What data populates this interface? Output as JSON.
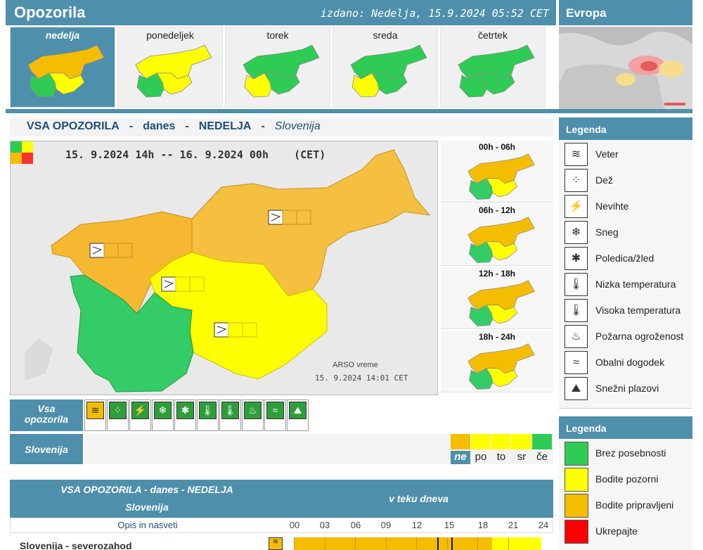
{
  "header": {
    "title": "Opozorila",
    "issued": "izdano: Nedelja, 15.9.2024 05:52 CET",
    "europe": "Evropa"
  },
  "days": [
    {
      "label": "nedelja",
      "active": true,
      "fill": [
        "#f5bd00",
        "#ffff00",
        "#2ecc54"
      ]
    },
    {
      "label": "ponedeljek",
      "active": false,
      "fill": [
        "#ffff00",
        "#ffff00",
        "#2ecc54"
      ]
    },
    {
      "label": "torek",
      "active": false,
      "fill": [
        "#2ecc54",
        "#2ecc54",
        "#ffff00"
      ]
    },
    {
      "label": "sreda",
      "active": false,
      "fill": [
        "#2ecc54",
        "#2ecc54",
        "#ffff00"
      ]
    },
    {
      "label": "četrtek",
      "active": false,
      "fill": [
        "#2ecc54",
        "#2ecc54",
        "#2ecc54"
      ]
    }
  ],
  "heading": {
    "a": "VSA OPOZORILA",
    "b": "danes",
    "c": "NEDELJA",
    "d": "Slovenija",
    "sep": "-"
  },
  "main_map": {
    "period": "15. 9.2024 14h -- 16. 9.2024 00h    (CET)",
    "credit": "ARSO vreme",
    "timestamp": "15. 9.2024  14:01 CET"
  },
  "periods": [
    "00h - 06h",
    "06h - 12h",
    "12h - 18h",
    "18h - 24h"
  ],
  "filters": {
    "all_label_1": "Vsa",
    "all_label_2": "opozorila",
    "region_label": "Slovenija",
    "type_icons": [
      "veter",
      "dez",
      "nevihte",
      "sneg",
      "poledica",
      "nizka-temp",
      "visoka-temp",
      "pozar",
      "obalni",
      "plazovi"
    ],
    "days": [
      {
        "label": "ne",
        "color": "#f5bd00",
        "current": true
      },
      {
        "label": "po",
        "color": "#ffff00",
        "current": false
      },
      {
        "label": "to",
        "color": "#ffff00",
        "current": false
      },
      {
        "label": "sr",
        "color": "#ffff00",
        "current": false
      },
      {
        "label": "če",
        "color": "#2ecc54",
        "current": false
      }
    ]
  },
  "table": {
    "title_1": "VSA OPOZORILA - danes - NEDELJA",
    "title_2": "Slovenija",
    "title_3": "v teku dneva",
    "tips": "Opis in nasveti",
    "hours": [
      "00",
      "03",
      "06",
      "09",
      "12",
      "15",
      "18",
      "21",
      "24"
    ],
    "row_name": "Slovenija - severozahod"
  },
  "legend1": {
    "title": "Legenda",
    "items": [
      {
        "name": "veter-icon",
        "label": "Veter",
        "glyph": "≋"
      },
      {
        "name": "rain-icon",
        "label": "Dež",
        "glyph": "⁘"
      },
      {
        "name": "storm-icon",
        "label": "Nevihte",
        "glyph": "⚡"
      },
      {
        "name": "snow-icon",
        "label": "Sneg",
        "glyph": "❄"
      },
      {
        "name": "ice-icon",
        "label": "Poledica/žled",
        "glyph": "✱"
      },
      {
        "name": "low-temp-icon",
        "label": "Nizka temperatura",
        "glyph": "🌡"
      },
      {
        "name": "high-temp-icon",
        "label": "Visoka temperatura",
        "glyph": "🌡"
      },
      {
        "name": "fire-icon",
        "label": "Požarna ogroženost",
        "glyph": "♨"
      },
      {
        "name": "coastal-icon",
        "label": "Obalni dogodek",
        "glyph": "≈"
      },
      {
        "name": "avalanche-icon",
        "label": "Snežni plazovi",
        "glyph": "⛰"
      }
    ]
  },
  "legend2": {
    "title": "Legenda",
    "items": [
      {
        "label": "Brez posebnosti",
        "color": "#2ecc54"
      },
      {
        "label": "Bodite pozorni",
        "color": "#ffff00"
      },
      {
        "label": "Bodite pripravljeni",
        "color": "#f5bd00"
      },
      {
        "label": "Ukrepajte",
        "color": "#ff0000"
      }
    ]
  }
}
